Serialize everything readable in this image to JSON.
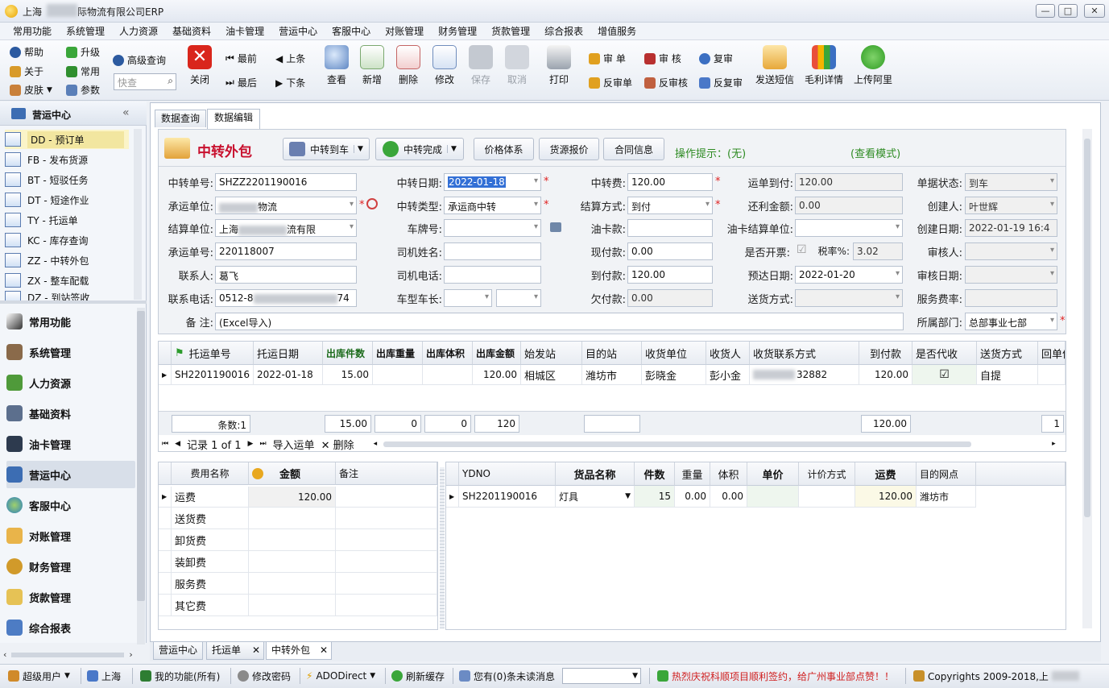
{
  "window": {
    "title_prefix": "上海",
    "title_suffix": "际物流有限公司ERP",
    "min_label": "—",
    "max_label": "□",
    "close_label": "✕"
  },
  "menu": [
    "常用功能",
    "系统管理",
    "人力资源",
    "基础资料",
    "油卡管理",
    "营运中心",
    "客服中心",
    "对账管理",
    "财务管理",
    "货款管理",
    "综合报表",
    "增值服务"
  ],
  "toolbar": {
    "help": "帮助",
    "upgrade": "升级",
    "advanced_query": "高级查询",
    "about": "关于",
    "common": "常用",
    "skin": "皮肤",
    "params": "参数",
    "search_placeholder": "快查",
    "close": "关闭",
    "first": "最前",
    "prev": "上条",
    "last": "最后",
    "next": "下条",
    "view": "查看",
    "add": "新增",
    "delete": "删除",
    "edit": "修改",
    "save": "保存",
    "cancel": "取消",
    "print": "打印",
    "audit_doc": "审 单",
    "review": "审 核",
    "final_review": "复审",
    "unaudit_doc": "反审单",
    "unreview": "反审核",
    "unfinal_review": "反复审",
    "send_sms": "发送短信",
    "profit": "毛利详情",
    "upload": "上传阿里"
  },
  "leftnav": {
    "header": "营运中心",
    "sub_items": [
      "DD - 预订单",
      "FB - 发布货源",
      "BT - 短驳任务",
      "DT - 短途作业",
      "TY - 托运单",
      "KC - 库存查询",
      "ZZ - 中转外包",
      "ZX - 整车配载",
      "DZ - 到站签收"
    ],
    "categories": [
      "常用功能",
      "系统管理",
      "人力资源",
      "基础资料",
      "油卡管理",
      "营运中心",
      "客服中心",
      "对账管理",
      "财务管理",
      "货款管理",
      "综合报表"
    ],
    "selected": "营运中心"
  },
  "tabs": {
    "query": "数据查询",
    "edit": "数据编辑"
  },
  "form": {
    "title": "中转外包",
    "btn_arrive": "中转到车",
    "btn_complete": "中转完成",
    "btn_price": "价格体系",
    "btn_quote": "货源报价",
    "btn_contract": "合同信息",
    "hint": "操作提示：(无)",
    "mode": "(查看模式)",
    "fields": {
      "zz_no_label": "中转单号:",
      "zz_no": "SHZZ2201190016",
      "zz_date_label": "中转日期:",
      "zz_date": "2022-01-18",
      "zz_fee_label": "中转费:",
      "zz_fee": "120.00",
      "arrive_pay_label": "运单到付:",
      "arrive_pay": "120.00",
      "status_label": "单据状态:",
      "status": "到车",
      "carrier_label": "承运单位:",
      "carrier": "物流",
      "zz_type_label": "中转类型:",
      "zz_type": "承运商中转",
      "settle_way_label": "结算方式:",
      "settle_way": "到付",
      "refund_label": "还利金额:",
      "refund": "0.00",
      "creator_label": "创建人:",
      "creator": "叶世辉",
      "settle_unit_label": "结算单位:",
      "settle_unit": "上海",
      "settle_unit_tail": "流有限",
      "plate_label": "车牌号:",
      "plate": "",
      "oilcard_label": "油卡款:",
      "oilcard": "",
      "oil_unit_label": "油卡结算单位:",
      "oil_unit": "",
      "create_date_label": "创建日期:",
      "create_date": "2022-01-19 16:4",
      "carrier_no_label": "承运单号:",
      "carrier_no": "220118007",
      "driver_label": "司机姓名:",
      "driver": "",
      "cash_label": "现付款:",
      "cash": "0.00",
      "invoice_label": "是否开票:",
      "tax_label": "税率%:",
      "tax": "3.02",
      "auditor_label": "审核人:",
      "auditor": "",
      "contact_label": "联系人:",
      "contact": "葛飞",
      "driver_phone_label": "司机电话:",
      "driver_phone": "",
      "arrive_label": "到付款:",
      "arrive": "120.00",
      "eta_label": "预达日期:",
      "eta": "2022-01-20",
      "audit_date_label": "审核日期:",
      "audit_date": "",
      "phone_label": "联系电话:",
      "phone_head": "0512-8",
      "phone_tail": "74",
      "car_label": "车型车长:",
      "owe_label": "欠付款:",
      "owe": "0.00",
      "delivery_label": "送货方式:",
      "delivery": "",
      "service_rate_label": "服务费率:",
      "service_rate": "",
      "note_label": "备 注:",
      "note": "(Excel导入)",
      "dept_label": "所属部门:",
      "dept": "总部事业七部"
    }
  },
  "waybill_grid": {
    "headers": [
      "托运单号",
      "托运日期",
      "出库件数",
      "出库重量",
      "出库体积",
      "出库金额",
      "始发站",
      "目的站",
      "收货单位",
      "收货人",
      "收货联系方式",
      "到付款",
      "是否代收",
      "送货方式",
      "回单份"
    ],
    "row": {
      "no": "SH2201190016",
      "date": "2022-01-18",
      "qty": "15.00",
      "weight": "",
      "volume": "",
      "amount": "120.00",
      "from": "相城区",
      "to": "潍坊市",
      "consignee_unit": "彭晓金",
      "consignee": "彭小金",
      "contact": "32882",
      "arrive": "120.00",
      "collect": "☑",
      "delivery": "自提"
    },
    "footer": {
      "count": "条数:1",
      "qty": "15.00",
      "weight": "0",
      "volume": "0",
      "amount": "120",
      "arrive": "120.00",
      "receipt": "1"
    },
    "nav": {
      "record": "记录 1 of 1",
      "import": "导入运单",
      "delete": "删除"
    }
  },
  "fee_grid": {
    "headers": [
      "费用名称",
      "金额",
      "备注"
    ],
    "rows": [
      {
        "name": "运费",
        "amount": "120.00"
      },
      {
        "name": "送货费",
        "amount": ""
      },
      {
        "name": "卸货费",
        "amount": ""
      },
      {
        "name": "装卸费",
        "amount": ""
      },
      {
        "name": "服务费",
        "amount": ""
      },
      {
        "name": "其它费",
        "amount": ""
      }
    ]
  },
  "goods_grid": {
    "headers": [
      "YDNO",
      "货品名称",
      "件数",
      "重量",
      "体积",
      "单价",
      "计价方式",
      "运费",
      "目的网点"
    ],
    "row": {
      "ydno": "SH2201190016",
      "name": "灯具",
      "qty": "15",
      "weight": "0.00",
      "volume": "0.00",
      "price": "",
      "method": "",
      "freight": "120.00",
      "dest": "潍坊市"
    }
  },
  "bottom_tabs": [
    "营运中心",
    "托运单",
    "中转外包"
  ],
  "statusbar": {
    "user": "超级用户",
    "city": "上海",
    "myfunc": "我的功能(所有)",
    "pwd": "修改密码",
    "ado": "ADODirect",
    "refresh": "刷新缓存",
    "msg": "您有(0)条未读消息",
    "notice": "热烈庆祝科顺项目顺利签约，给广州事业部点赞！！",
    "copyright": "Copyrights 2009-2018,上"
  },
  "colors": {
    "accent_red": "#c8102e",
    "hint_green": "#2e8b23"
  }
}
